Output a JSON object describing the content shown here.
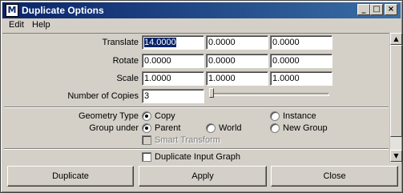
{
  "window": {
    "title": "Duplicate Options",
    "app_icon": "maya-icon"
  },
  "title_buttons": {
    "minimize": "_",
    "maximize": "□",
    "close": "×"
  },
  "menu": [
    "Edit",
    "Help"
  ],
  "transform": {
    "translate": {
      "label": "Translate",
      "values": [
        "14.0000",
        "0.0000",
        "0.0000"
      ]
    },
    "rotate": {
      "label": "Rotate",
      "values": [
        "0.0000",
        "0.0000",
        "0.0000"
      ]
    },
    "scale": {
      "label": "Scale",
      "values": [
        "1.0000",
        "1.0000",
        "1.0000"
      ]
    }
  },
  "copies": {
    "label": "Number of Copies",
    "value": "3",
    "slider_fraction": 0.0
  },
  "geometry_type": {
    "label": "Geometry Type",
    "options": [
      "Copy",
      "Instance"
    ],
    "selected": "Copy"
  },
  "group_under": {
    "label": "Group under",
    "options": [
      "Parent",
      "World",
      "New Group"
    ],
    "selected": "Parent"
  },
  "smart_transform": {
    "label": "Smart Transform",
    "enabled": false
  },
  "duplicate_input_graph": {
    "label": "Duplicate Input Graph",
    "checked": false
  },
  "buttons": {
    "duplicate": "Duplicate",
    "apply": "Apply",
    "close": "Close"
  },
  "scroll_arrows": {
    "up": "▲",
    "down": "▼"
  }
}
